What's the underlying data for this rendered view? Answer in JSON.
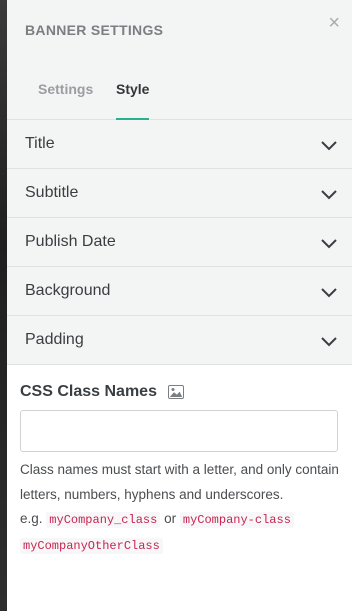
{
  "panel": {
    "title": "BANNER SETTINGS",
    "close_icon": "×"
  },
  "tabs": [
    {
      "label": "Settings",
      "active": false
    },
    {
      "label": "Style",
      "active": true
    }
  ],
  "accordion": [
    {
      "label": "Title"
    },
    {
      "label": "Subtitle"
    },
    {
      "label": "Publish Date"
    },
    {
      "label": "Background"
    },
    {
      "label": "Padding"
    }
  ],
  "css_classes": {
    "title": "CSS Class Names",
    "icon": "image-icon",
    "input_value": "",
    "help_text": "Class names must start with a letter, and only contain letters, numbers, hyphens and underscores.",
    "example_prefix": "e.g.",
    "example_1": "myCompany_class",
    "example_or": "or",
    "example_2": "myCompany-class",
    "example_3": "myCompanyOtherClass"
  },
  "colors": {
    "accent": "#29b18f",
    "code_text": "#c7254e"
  }
}
